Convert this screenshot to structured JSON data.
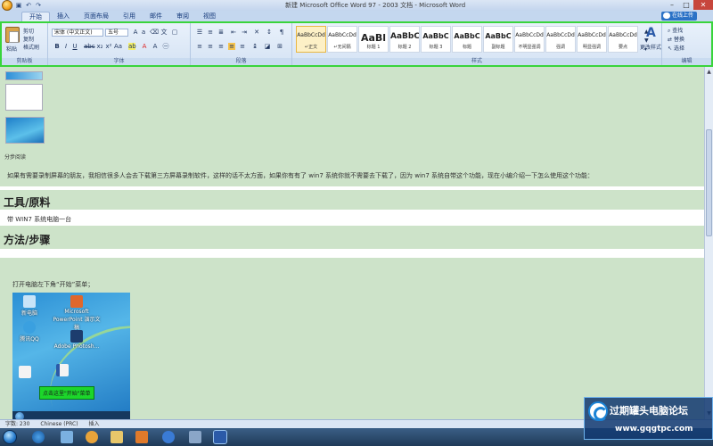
{
  "titlebar": {
    "title": "新建 Microsoft Office Word 97 - 2003 文档 - Microsoft Word"
  },
  "tabs": [
    "开始",
    "插入",
    "页面布局",
    "引用",
    "邮件",
    "审阅",
    "视图"
  ],
  "online_button": "在线上传",
  "ribbon": {
    "clipboard": {
      "paste_label": "粘贴",
      "cut_label": "剪切",
      "copy_label": "复制",
      "format_painter_label": "格式刷",
      "group_label": "剪贴板"
    },
    "font": {
      "font_name": "宋体 (中文正文)",
      "font_size": "五号",
      "group_label": "字体"
    },
    "paragraph": {
      "group_label": "段落"
    },
    "styles": {
      "items": [
        {
          "sample": "AaBbCcDd",
          "name": "↵正文"
        },
        {
          "sample": "AaBbCcDd",
          "name": "↵无间隔"
        },
        {
          "sample": "AaBl",
          "name": "标题 1"
        },
        {
          "sample": "AaBbC",
          "name": "标题 2"
        },
        {
          "sample": "AaBbC",
          "name": "标题 3"
        },
        {
          "sample": "AaBbC",
          "name": "标题"
        },
        {
          "sample": "AaBbC",
          "name": "副标题"
        },
        {
          "sample": "AaBbCcDd",
          "name": "不明显强调"
        },
        {
          "sample": "AaBbCcDd",
          "name": "强调"
        },
        {
          "sample": "AaBbCcDd",
          "name": "明显强调"
        },
        {
          "sample": "AaBbCcDd",
          "name": "要点"
        }
      ],
      "change_styles_label": "更改样式",
      "group_label": "样式"
    },
    "editing": {
      "find_label": "查找",
      "replace_label": "替换",
      "select_label": "选择",
      "group_label": "编辑"
    }
  },
  "document": {
    "step_read": "分步阅读",
    "intro": "如果有需要录制屏幕的朋友，我相信很多人会去下载第三方屏幕录制软件，这样的话不太方面，如果你有有了 win7 系统你就不需要去下载了，因为 win7 系统自带这个功能，现在小编介绍一下怎么使用这个功能：",
    "tools_heading": "工具/原料",
    "tools_item": "带 WIN7 系统电脑一台",
    "steps_heading": "方法/步骤",
    "step1": "打开电脑左下角“开始”菜单；",
    "screenshot": {
      "icon1": "新电脑",
      "icon2": "Microsoft PowerPoint 演示文稿",
      "icon3": "腾讯QQ",
      "icon4": "Adobe Photosh...",
      "callout": "点击这里\"开始\"菜单"
    }
  },
  "statusbar": {
    "words": "字数: 230",
    "language": "Chinese (PRC)",
    "mode": "插入"
  },
  "watermark": {
    "title": "过期罐头电脑论坛",
    "url": "www.gqgtpc.com"
  }
}
